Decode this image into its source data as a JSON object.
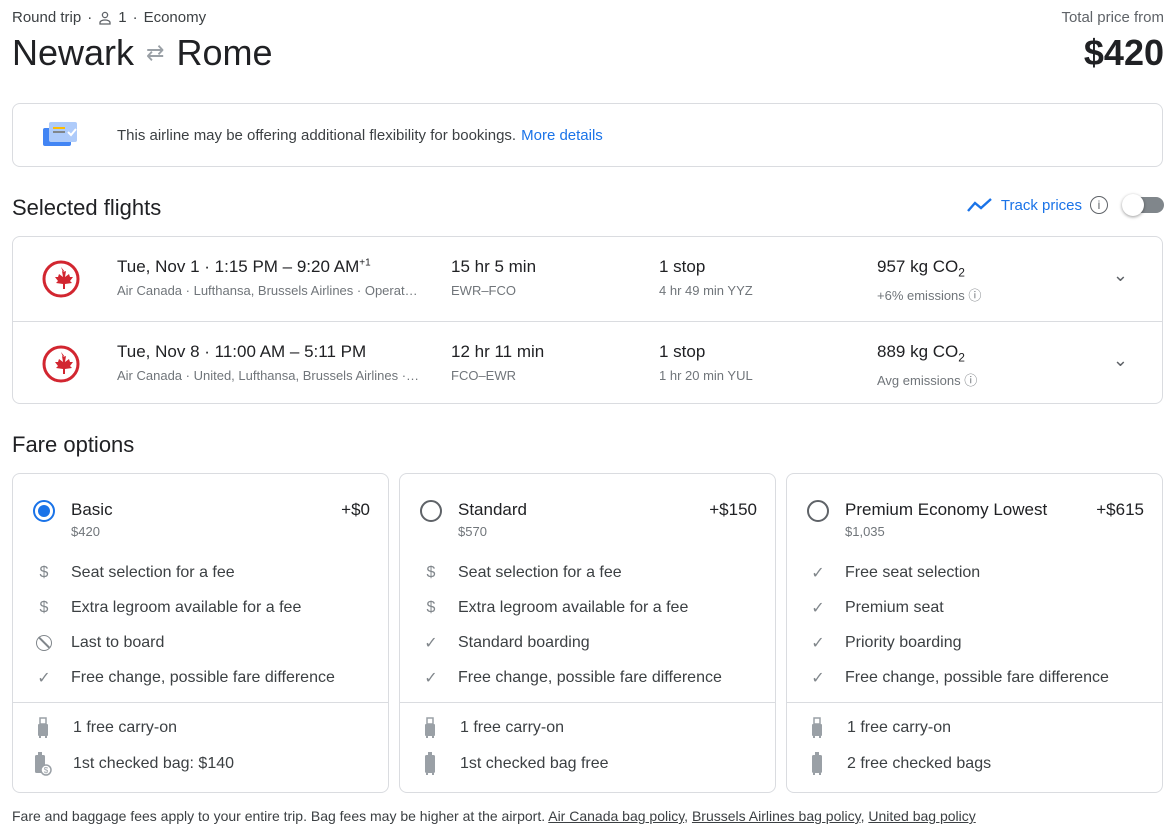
{
  "header": {
    "trip_type": "Round trip",
    "passengers": "1",
    "cabin": "Economy",
    "origin": "Newark",
    "destination": "Rome",
    "total_label": "Total price from",
    "total_price": "$420"
  },
  "banner": {
    "text": "This airline may be offering additional flexibility for bookings.",
    "link": "More details"
  },
  "selected": {
    "title": "Selected flights",
    "track_label": "Track prices"
  },
  "flights": [
    {
      "date": "Tue, Nov 1",
      "times": "1:15 PM – 9:20 AM",
      "plus": "+1",
      "airlines": "Air Canada · Lufthansa, Brussels Airlines · Operat…",
      "duration": "15 hr 5 min",
      "route": "EWR–FCO",
      "stops": "1 stop",
      "layover": "4 hr 49 min YYZ",
      "co2": "957 kg CO",
      "emissions": "+6% emissions"
    },
    {
      "date": "Tue, Nov 8",
      "times": "11:00 AM – 5:11 PM",
      "plus": "",
      "airlines": "Air Canada · United, Lufthansa, Brussels Airlines ·…",
      "duration": "12 hr 11 min",
      "route": "FCO–EWR",
      "stops": "1 stop",
      "layover": "1 hr 20 min YUL",
      "co2": "889 kg CO",
      "emissions": "Avg emissions"
    }
  ],
  "fares": {
    "title": "Fare options",
    "cards": [
      {
        "name": "Basic",
        "price": "$420",
        "delta": "+$0",
        "selected": true,
        "features": [
          {
            "icon": "$",
            "text": "Seat selection for a fee"
          },
          {
            "icon": "$",
            "text": "Extra legroom available for a fee"
          },
          {
            "icon": "⃠",
            "text": "Last to board"
          },
          {
            "icon": "✓",
            "text": "Free change, possible fare difference"
          }
        ],
        "bags": [
          "1 free carry-on",
          "1st checked bag: $140"
        ]
      },
      {
        "name": "Standard",
        "price": "$570",
        "delta": "+$150",
        "selected": false,
        "features": [
          {
            "icon": "$",
            "text": "Seat selection for a fee"
          },
          {
            "icon": "$",
            "text": "Extra legroom available for a fee"
          },
          {
            "icon": "✓",
            "text": "Standard boarding"
          },
          {
            "icon": "✓",
            "text": "Free change, possible fare difference"
          }
        ],
        "bags": [
          "1 free carry-on",
          "1st checked bag free"
        ]
      },
      {
        "name": "Premium Economy Lowest",
        "price": "$1,035",
        "delta": "+$615",
        "selected": false,
        "features": [
          {
            "icon": "✓",
            "text": "Free seat selection"
          },
          {
            "icon": "✓",
            "text": "Premium seat"
          },
          {
            "icon": "✓",
            "text": "Priority boarding"
          },
          {
            "icon": "✓",
            "text": "Free change, possible fare difference"
          }
        ],
        "bags": [
          "1 free carry-on",
          "2 free checked bags"
        ]
      }
    ]
  },
  "footer": {
    "text": "Fare and baggage fees apply to your entire trip. Bag fees may be higher at the airport.",
    "links": [
      "Air Canada bag policy",
      "Brussels Airlines bag policy",
      "United bag policy"
    ]
  }
}
